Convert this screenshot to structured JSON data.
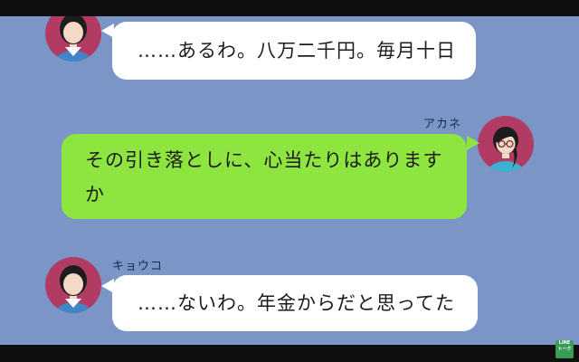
{
  "messages": [
    {
      "sender": "",
      "text": "……あるわ。八万二千円。毎月十日"
    },
    {
      "sender": "アカネ",
      "text": "その引き落としに、心当たりはありますか"
    },
    {
      "sender": "キョウコ",
      "text": "……ないわ。年金からだと思ってた"
    }
  ],
  "watermark": {
    "line1": "LINE",
    "line2": "トーク"
  },
  "colors": {
    "chat_background": "#7b96c6",
    "incoming_bubble": "#ffffff",
    "outgoing_bubble": "#8fe540",
    "avatar_background": "#b23b63"
  },
  "icons": {
    "incoming_avatar": "woman-dark-hair-avatar-icon",
    "outgoing_avatar": "woman-glasses-ponytail-avatar-icon"
  }
}
